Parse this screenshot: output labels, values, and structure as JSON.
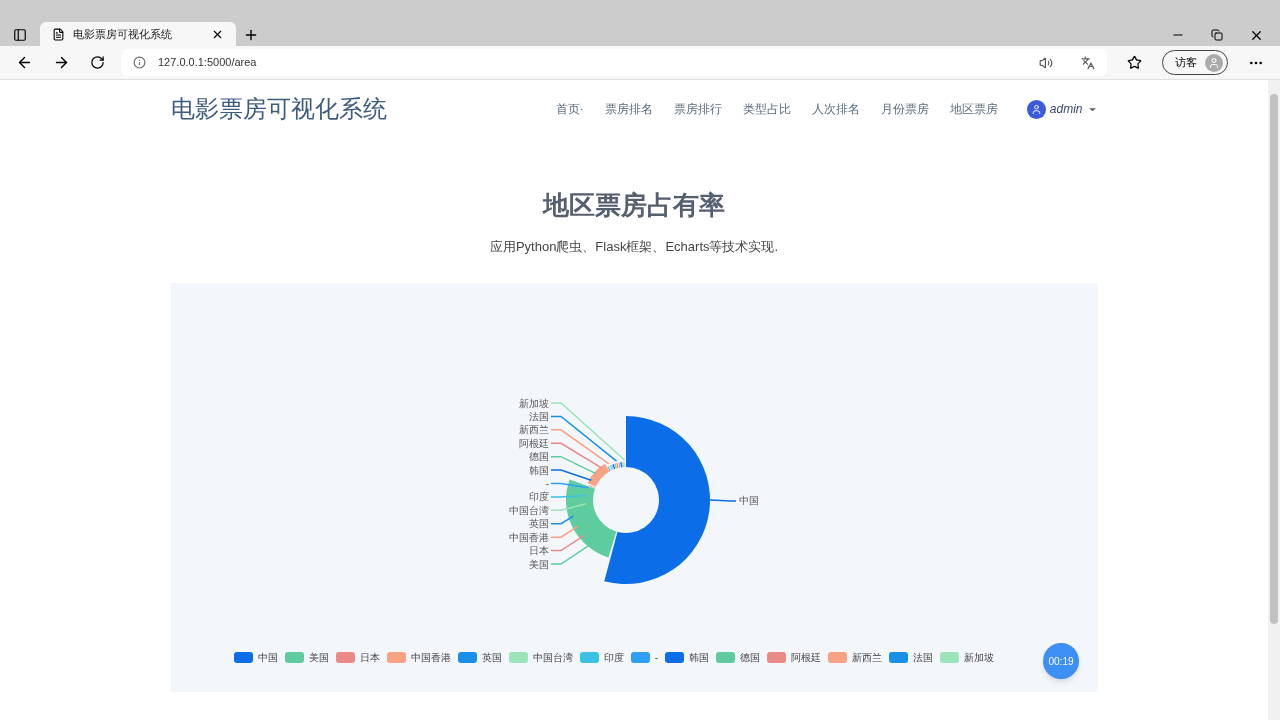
{
  "browser": {
    "tab_title": "电影票房可视化系统",
    "url": "127.0.0.1:5000/area",
    "profile": "访客"
  },
  "header": {
    "brand": "电影票房可视化系统",
    "nav": [
      "首页·",
      "票房排名",
      "票房排行",
      "类型占比",
      "人次排名",
      "月份票房",
      "地区票房"
    ],
    "user": "admin"
  },
  "hero": {
    "title": "地区票房占有率",
    "subtitle": "应用Python爬虫、Flask框架、Echarts等技术实现."
  },
  "chart": {
    "labels": [
      {
        "text": "新加坡",
        "color": "#9be3b8"
      },
      {
        "text": "法国",
        "color": "#1a8fe8"
      },
      {
        "text": "新西兰",
        "color": "#f7a283"
      },
      {
        "text": "阿根廷",
        "color": "#ea8a86"
      },
      {
        "text": "德国",
        "color": "#5fcca0"
      },
      {
        "text": "韩国",
        "color": "#0b6ee8"
      },
      {
        "text": "-",
        "color": "#2f9ef5"
      },
      {
        "text": "印度",
        "color": "#3bc1e3"
      },
      {
        "text": "中国台湾",
        "color": "#9be3b8"
      },
      {
        "text": "英国",
        "color": "#1a8fe8"
      },
      {
        "text": "中国香港",
        "color": "#f7a283"
      },
      {
        "text": "日本",
        "color": "#ea8a86"
      },
      {
        "text": "美国",
        "color": "#5fcca0"
      }
    ],
    "right_label": {
      "text": "中国",
      "color": "#0b6ee8"
    },
    "legend": [
      {
        "name": "中国",
        "color": "#0b6ee8"
      },
      {
        "name": "美国",
        "color": "#5fcca0"
      },
      {
        "name": "日本",
        "color": "#ea8a86"
      },
      {
        "name": "中国香港",
        "color": "#f7a283"
      },
      {
        "name": "英国",
        "color": "#1a8fe8"
      },
      {
        "name": "中国台湾",
        "color": "#9be3b8"
      },
      {
        "name": "印度",
        "color": "#3bc1e3"
      },
      {
        "name": "-",
        "color": "#2f9ef5"
      },
      {
        "name": "韩国",
        "color": "#0b6ee8"
      },
      {
        "name": "德国",
        "color": "#5fcca0"
      },
      {
        "name": "阿根廷",
        "color": "#ea8a86"
      },
      {
        "name": "新西兰",
        "color": "#f7a283"
      },
      {
        "name": "法国",
        "color": "#1a8fe8"
      },
      {
        "name": "新加坡",
        "color": "#9be3b8"
      }
    ]
  },
  "timer": "00:19"
}
